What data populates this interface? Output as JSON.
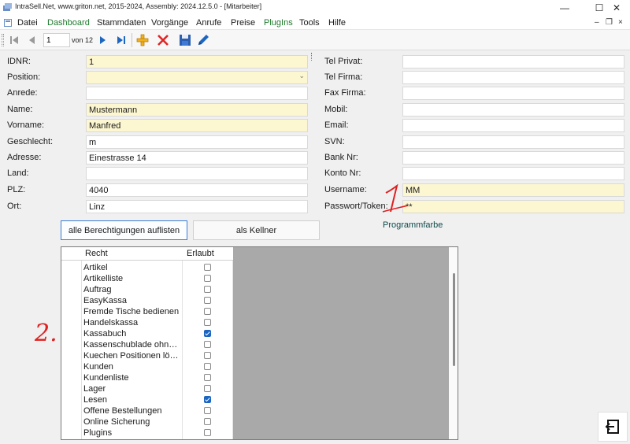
{
  "window": {
    "title": "IntraSell.Net, www.griton.net, 2015-2024, Assembly: 2024.12.5.0 - [Mitarbeiter]",
    "minimize_glyph": "—",
    "maximize_glyph": "☐",
    "close_glyph": "✕"
  },
  "menu": {
    "items": [
      "Datei",
      "Dashboard",
      "Stammdaten",
      "Vorgänge",
      "Anrufe",
      "Preise",
      "PlugIns",
      "Tools",
      "Hilfe"
    ],
    "mdi_minimize": "–",
    "mdi_restore": "❐",
    "mdi_close": "×"
  },
  "toolbar": {
    "record_value": "1",
    "record_count": "von 12",
    "icons": [
      "first-record-icon",
      "prev-record-icon",
      "next-record-icon",
      "last-record-icon",
      "add-icon",
      "delete-icon",
      "save-icon",
      "edit-icon"
    ]
  },
  "form": {
    "left": [
      {
        "label": "IDNR:",
        "value": "1",
        "required": true
      },
      {
        "label": "Position:",
        "value": "",
        "required": true,
        "dropdown": true
      },
      {
        "label": "Anrede:",
        "value": "",
        "required": false
      },
      {
        "label": "Name:",
        "value": "Mustermann",
        "required": true
      },
      {
        "label": "Vorname:",
        "value": "Manfred",
        "required": true
      },
      {
        "label": "Geschlecht:",
        "value": "m",
        "required": false
      },
      {
        "label": "Adresse:",
        "value": "Einestrasse 14",
        "required": false
      },
      {
        "label": "Land:",
        "value": "",
        "required": false
      },
      {
        "label": "PLZ:",
        "value": "4040",
        "required": false
      },
      {
        "label": "Ort:",
        "value": "Linz",
        "required": false
      }
    ],
    "right": [
      {
        "label": "Tel Privat:",
        "value": "",
        "required": false
      },
      {
        "label": "Tel Firma:",
        "value": "",
        "required": false
      },
      {
        "label": "Fax Firma:",
        "value": "",
        "required": false
      },
      {
        "label": "Mobil:",
        "value": "",
        "required": false
      },
      {
        "label": "Email:",
        "value": "",
        "required": false
      },
      {
        "label": "SVN:",
        "value": "",
        "required": false
      },
      {
        "label": "Bank Nr:",
        "value": "",
        "required": false
      },
      {
        "label": "Konto Nr:",
        "value": "",
        "required": false
      },
      {
        "label": "Username:",
        "value": "MM",
        "required": true
      },
      {
        "label": "Passwort/Token:",
        "value": "**",
        "required": true
      }
    ]
  },
  "actions": {
    "list_permissions": "alle Berechtigungen auflisten",
    "as_waiter": "als Kellner",
    "program_color": "Programmfarbe"
  },
  "permissions": {
    "columns": [
      "Recht",
      "Erlaubt"
    ],
    "rows": [
      {
        "name": "Artikel",
        "allowed": false
      },
      {
        "name": "Artikelliste",
        "allowed": false
      },
      {
        "name": "Auftrag",
        "allowed": false
      },
      {
        "name": "EasyKassa",
        "allowed": false
      },
      {
        "name": "Fremde Tische bedienen",
        "allowed": false
      },
      {
        "name": "Handelskassa",
        "allowed": false
      },
      {
        "name": "Kassabuch",
        "allowed": true
      },
      {
        "name": "Kassenschublade ohne ...",
        "allowed": false
      },
      {
        "name": "Kuechen Positionen lösc...",
        "allowed": false
      },
      {
        "name": "Kunden",
        "allowed": false
      },
      {
        "name": "Kundenliste",
        "allowed": false
      },
      {
        "name": "Lager",
        "allowed": false
      },
      {
        "name": "Lesen",
        "allowed": true
      },
      {
        "name": "Offene Bestellungen",
        "allowed": false
      },
      {
        "name": "Online Sicherung",
        "allowed": false
      },
      {
        "name": "Plugins",
        "allowed": false
      }
    ]
  },
  "annotations": {
    "one": "1",
    "two": "2."
  },
  "colors": {
    "required_field": "#fdf7d1",
    "menu_green": "#1e7a2d",
    "accent_blue": "#1c66c2",
    "annotation_red": "#e02020"
  }
}
